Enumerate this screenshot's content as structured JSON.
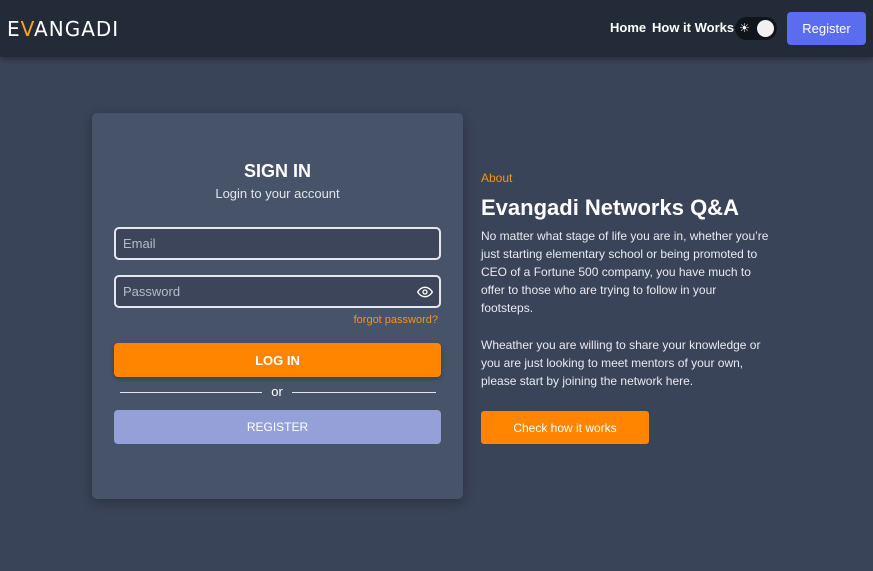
{
  "header": {
    "logo_prefix": "E",
    "logo_accent": "V",
    "logo_suffix": "ANGADI",
    "nav": {
      "home": "Home",
      "how_it_works": "How it Works"
    },
    "theme_toggle_icon": "☀",
    "register_label": "Register"
  },
  "signin": {
    "title": "SIGN IN",
    "subtitle": "Login to your account",
    "email_placeholder": "Email",
    "email_value": "",
    "password_placeholder": "Password",
    "password_value": "",
    "forgot_label": "forgot password?",
    "login_label": "LOG IN",
    "divider_text": "or",
    "register_label": "REGISTER"
  },
  "about": {
    "label": "About",
    "title": "Evangadi Networks Q&A",
    "paragraph1": "No matter what stage of life you are in, whether you’re just starting elementary school or being promoted to CEO of a Fortune 500 company, you have much to offer to those who are trying to follow in your footsteps.",
    "paragraph2": "Wheather you are willing to share your knowledge or you are just looking to meet mentors of your own, please start by joining the network here.",
    "cta_label": "Check how it works"
  },
  "colors": {
    "background": "#3a4458",
    "header": "#232b38",
    "card": "#465368",
    "accent_orange": "#ff8500",
    "register_blue": "#5b6cf0",
    "register_muted": "#95a0d9"
  },
  "icons": {
    "theme_toggle": "sun-icon",
    "password_visibility": "eye-icon"
  }
}
